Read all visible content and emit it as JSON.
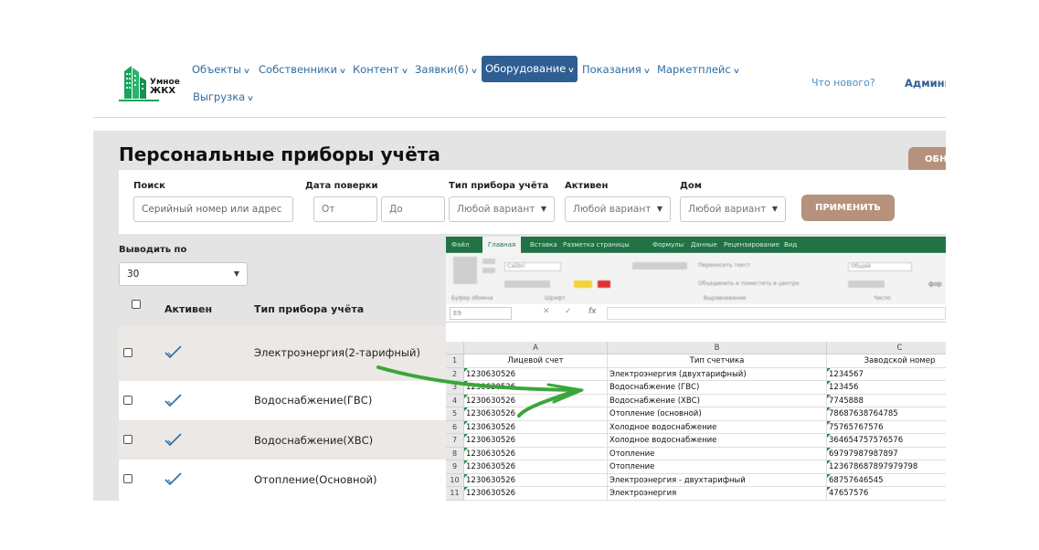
{
  "header": {
    "logo_line1": "Умное",
    "logo_line2": "ЖКХ",
    "nav": [
      {
        "label": "Объекты"
      },
      {
        "label": "Собственники"
      },
      {
        "label": "Контент"
      },
      {
        "label": "Заявки(6)"
      },
      {
        "label": "Оборудование",
        "active": true
      },
      {
        "label": "Показания"
      },
      {
        "label": "Маркетплейс"
      },
      {
        "label": "Выгрузка"
      }
    ],
    "whats_new": "Что нового?",
    "admin": "Админи"
  },
  "page": {
    "title": "Персональные приборы учёта",
    "refresh_label": "ОБНО"
  },
  "filters": {
    "search_label": "Поиск",
    "search_placeholder": "Серийный номер или адрес",
    "date_label": "Дата поверки",
    "date_from": "От",
    "date_to": "До",
    "type_label": "Тип прибора учёта",
    "type_value": "Любой вариант",
    "active_label": "Активен",
    "active_value": "Любой вариант",
    "house_label": "Дом",
    "house_value": "Любой вариант",
    "apply_label": "ПРИМЕНИТЬ"
  },
  "table": {
    "perpage_label": "Выводить по",
    "perpage_value": "30",
    "col_active": "Активен",
    "col_type": "Тип прибора учёта",
    "rows": [
      {
        "type": "Электроэнергия(2-тарифный)",
        "active": true
      },
      {
        "type": "Водоснабжение(ГВС)",
        "active": true
      },
      {
        "type": "Водоснабжение(ХВС)",
        "active": true
      },
      {
        "type": "Отопление(Основной)",
        "active": true
      }
    ]
  },
  "excel": {
    "tabs": [
      "Файл",
      "Главная",
      "Вставка",
      "Разметка страницы",
      "Формулы",
      "Данные",
      "Рецензирование",
      "Вид"
    ],
    "ribbon_groups": [
      "Буфер обмена",
      "Шрифт",
      "Выравнивание",
      "Число"
    ],
    "ribbon_font": "Calibri",
    "ribbon_wrap": "Переносить текст",
    "ribbon_merge": "Объединить и поместить в центре",
    "ribbon_number": "Общий",
    "ribbon_formats": "фор",
    "name_box": "E9",
    "fx_label": "fx",
    "columns": [
      "A",
      "B",
      "C"
    ],
    "header_row": [
      "Лицевой счет",
      "Тип счетчика",
      "Заводской номер"
    ],
    "rows": [
      [
        "1230630526",
        "Электроэнергия (двухтарифный)",
        "1234567"
      ],
      [
        "1230630526",
        "Водоснабжение (ГВС)",
        "123456"
      ],
      [
        "1230630526",
        "Водоснабжение (ХВС)",
        "7745888"
      ],
      [
        "1230630526",
        "Отопление (основной)",
        "78687638764785"
      ],
      [
        "1230630526",
        "Холодное водоснабжение",
        "75765767576"
      ],
      [
        "1230630526",
        "Холодное водоснабжение",
        "364654757576576"
      ],
      [
        "1230630526",
        "Отопление",
        "69797987987897"
      ],
      [
        "1230630526",
        "Отопление",
        "123678687897979798"
      ],
      [
        "1230630526",
        "Электроэнергия - двухтарифный",
        "68757646545"
      ],
      [
        "1230630526",
        "Электроэнергия",
        "47657576"
      ]
    ]
  },
  "colors": {
    "nav_link": "#2f6da3",
    "nav_active_bg": "#2f5e92",
    "accent_button": "#b6917b",
    "excel_green": "#217346",
    "arrow_green": "#3aa63a",
    "check_blue": "#2f6da3"
  }
}
